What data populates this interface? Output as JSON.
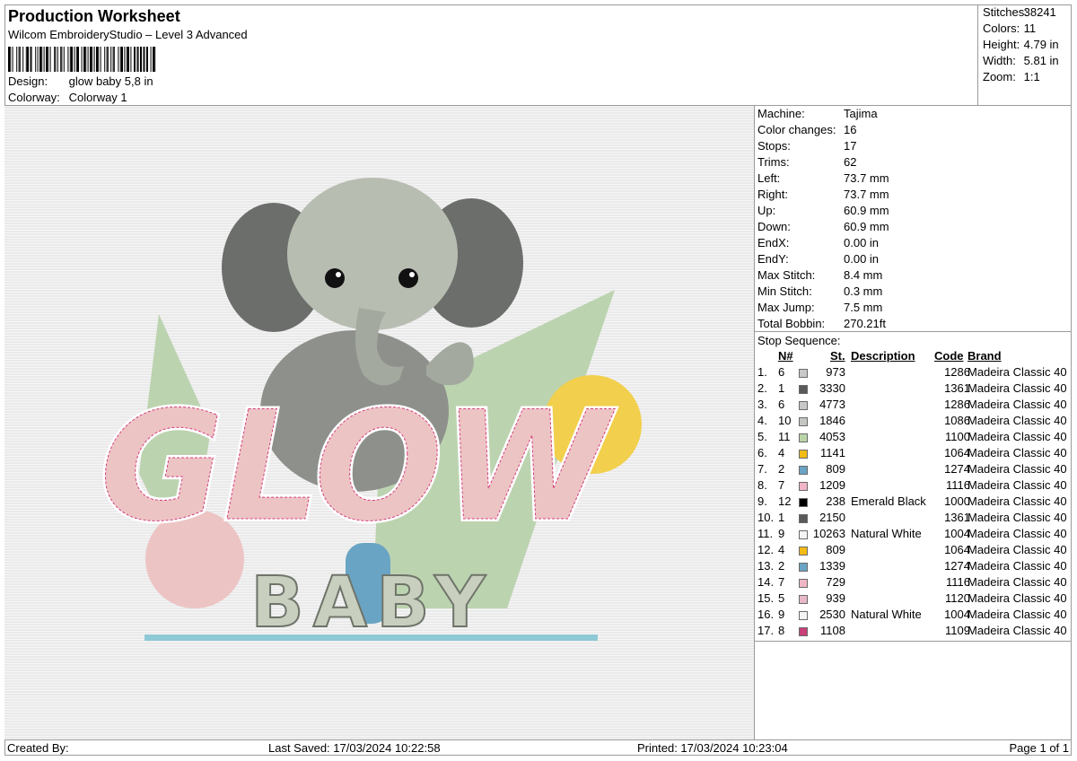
{
  "header": {
    "title": "Production Worksheet",
    "software": "Wilcom EmbroideryStudio – Level 3 Advanced",
    "design_label": "Design:",
    "design_value": "glow baby 5,8 in",
    "colorway_label": "Colorway:",
    "colorway_value": "Colorway 1"
  },
  "summary": [
    {
      "label": "Stitches:",
      "value": "38241"
    },
    {
      "label": "Colors:",
      "value": "11"
    },
    {
      "label": "Height:",
      "value": "4.79 in"
    },
    {
      "label": "Width:",
      "value": "5.81 in"
    },
    {
      "label": "Zoom:",
      "value": "1:1"
    }
  ],
  "machine_info": [
    {
      "label": "Machine:",
      "value": "Tajima"
    },
    {
      "label": "Color changes:",
      "value": "16"
    },
    {
      "label": "Stops:",
      "value": "17"
    },
    {
      "label": "Trims:",
      "value": "62"
    },
    {
      "label": "Left:",
      "value": "73.7 mm"
    },
    {
      "label": "Right:",
      "value": "73.7 mm"
    },
    {
      "label": "Up:",
      "value": "60.9 mm"
    },
    {
      "label": "Down:",
      "value": "60.9 mm"
    },
    {
      "label": "EndX:",
      "value": "0.00 in"
    },
    {
      "label": "EndY:",
      "value": "0.00 in"
    },
    {
      "label": "Max Stitch:",
      "value": "8.4 mm"
    },
    {
      "label": "Min Stitch:",
      "value": "0.3 mm"
    },
    {
      "label": "Max Jump:",
      "value": "7.5 mm"
    },
    {
      "label": "Total Bobbin:",
      "value": "270.21ft"
    }
  ],
  "stop_sequence": {
    "label": "Stop Sequence:",
    "columns": {
      "n": "N#",
      "st": "St.",
      "description": "Description",
      "code": "Code",
      "brand": "Brand"
    },
    "rows": [
      {
        "idx": "1.",
        "n": "6",
        "color": "#c8c8c8",
        "st": "973",
        "desc": "",
        "code": "1286",
        "brand": "Madeira Classic 40"
      },
      {
        "idx": "2.",
        "n": "1",
        "color": "#5a5a5a",
        "st": "3330",
        "desc": "",
        "code": "1361",
        "brand": "Madeira Classic 40"
      },
      {
        "idx": "3.",
        "n": "6",
        "color": "#c8c8c8",
        "st": "4773",
        "desc": "",
        "code": "1286",
        "brand": "Madeira Classic 40"
      },
      {
        "idx": "4.",
        "n": "10",
        "color": "#c4c6c2",
        "st": "1846",
        "desc": "",
        "code": "1086",
        "brand": "Madeira Classic 40"
      },
      {
        "idx": "5.",
        "n": "11",
        "color": "#b9d5a8",
        "st": "4053",
        "desc": "",
        "code": "1100",
        "brand": "Madeira Classic 40"
      },
      {
        "idx": "6.",
        "n": "4",
        "color": "#f2bb16",
        "st": "1141",
        "desc": "",
        "code": "1064",
        "brand": "Madeira Classic 40"
      },
      {
        "idx": "7.",
        "n": "2",
        "color": "#6aa4c4",
        "st": "809",
        "desc": "",
        "code": "1274",
        "brand": "Madeira Classic 40"
      },
      {
        "idx": "8.",
        "n": "7",
        "color": "#f0b5c6",
        "st": "1209",
        "desc": "",
        "code": "1116",
        "brand": "Madeira Classic 40"
      },
      {
        "idx": "9.",
        "n": "12",
        "color": "#000000",
        "st": "238",
        "desc": "Emerald Black",
        "code": "1000",
        "brand": "Madeira Classic 40"
      },
      {
        "idx": "10.",
        "n": "1",
        "color": "#5a5a5a",
        "st": "2150",
        "desc": "",
        "code": "1361",
        "brand": "Madeira Classic 40"
      },
      {
        "idx": "11.",
        "n": "9",
        "color": "#f4f4f4",
        "st": "10263",
        "desc": "Natural White",
        "code": "1004",
        "brand": "Madeira Classic 40"
      },
      {
        "idx": "12.",
        "n": "4",
        "color": "#f2bb16",
        "st": "809",
        "desc": "",
        "code": "1064",
        "brand": "Madeira Classic 40"
      },
      {
        "idx": "13.",
        "n": "2",
        "color": "#6aa4c4",
        "st": "1339",
        "desc": "",
        "code": "1274",
        "brand": "Madeira Classic 40"
      },
      {
        "idx": "14.",
        "n": "7",
        "color": "#f0b5c6",
        "st": "729",
        "desc": "",
        "code": "1116",
        "brand": "Madeira Classic 40"
      },
      {
        "idx": "15.",
        "n": "5",
        "color": "#e8b8c8",
        "st": "939",
        "desc": "",
        "code": "1120",
        "brand": "Madeira Classic 40"
      },
      {
        "idx": "16.",
        "n": "9",
        "color": "#f4f4f4",
        "st": "2530",
        "desc": "Natural White",
        "code": "1004",
        "brand": "Madeira Classic 40"
      },
      {
        "idx": "17.",
        "n": "8",
        "color": "#c8407a",
        "st": "1108",
        "desc": "",
        "code": "1109",
        "brand": "Madeira Classic 40"
      }
    ]
  },
  "design_preview": {
    "word_top": "GLOW",
    "word_bottom": "BABY",
    "colors": {
      "ears": "#6b6e6a",
      "body": "#b8bdb2",
      "triangle": "#bcd3b0",
      "yellow": "#f2cf4c",
      "pink": "#edc4c4",
      "blue": "#8ec9d6",
      "outline": "#d0407a"
    }
  },
  "footer": {
    "created_by": "Created By:",
    "last_saved": "Last Saved: 17/03/2024 10:22:58",
    "printed": "Printed: 17/03/2024 10:23:04",
    "page": "Page 1 of 1"
  }
}
